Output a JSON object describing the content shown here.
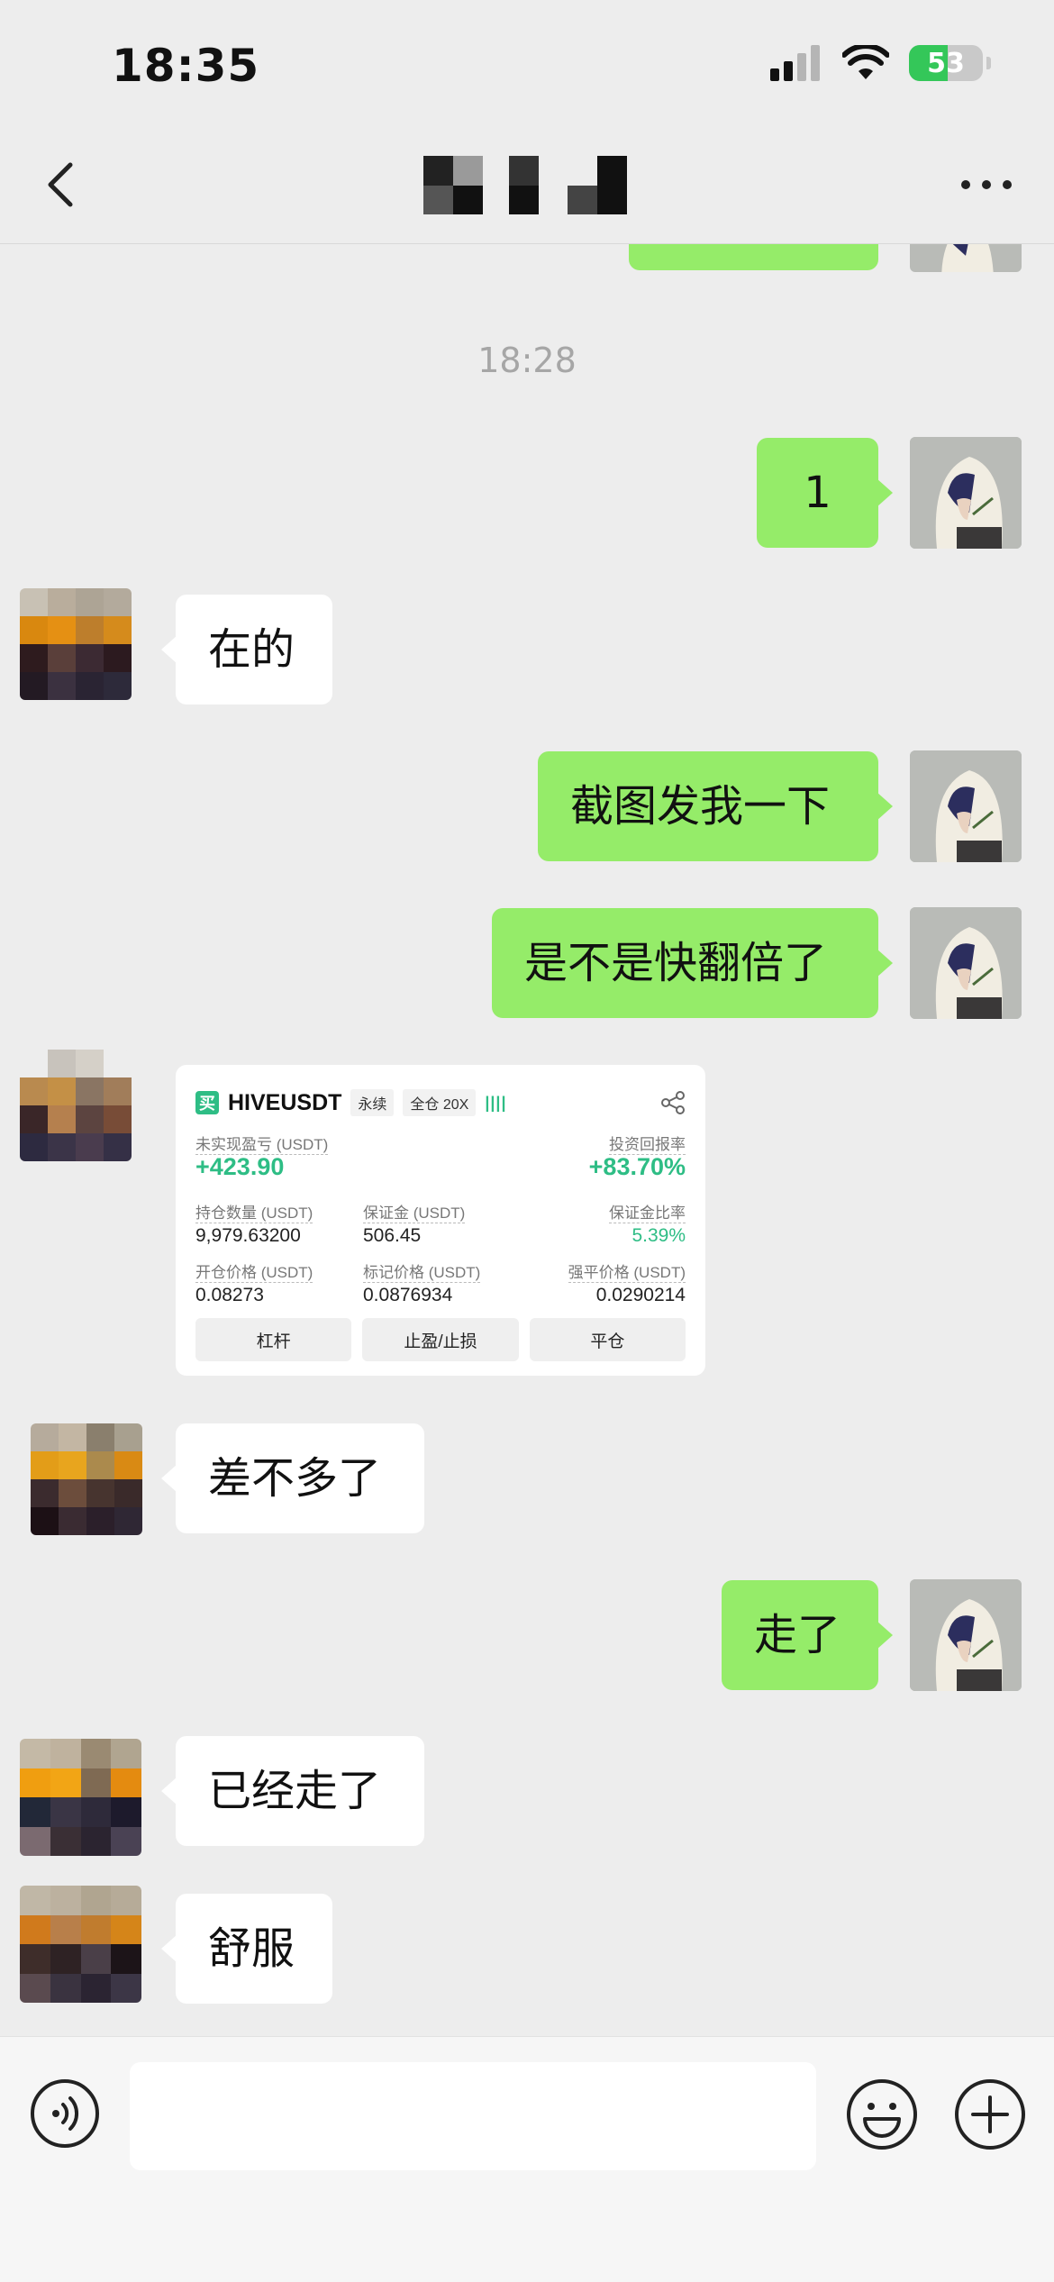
{
  "status_bar": {
    "time": "18:35",
    "battery": "53",
    "battery_level": 0.53
  },
  "header": {
    "title": ""
  },
  "chat": {
    "timestamp": "18:28",
    "messages": [
      {
        "from": "me",
        "text": "1"
      },
      {
        "from": "other",
        "text": "在的"
      },
      {
        "from": "me",
        "text": "截图发我一下"
      },
      {
        "from": "me",
        "text": "是不是快翻倍了"
      },
      {
        "from": "other",
        "type": "image"
      },
      {
        "from": "other",
        "text": "差不多了"
      },
      {
        "from": "me",
        "text": "走了"
      },
      {
        "from": "other",
        "text": "已经走了"
      },
      {
        "from": "other",
        "text": "舒服"
      }
    ]
  },
  "trade_card": {
    "buy_tag": "买",
    "pair": "HIVEUSDT",
    "contract_type": "永续",
    "margin_mode": "全仓 20X",
    "strength_bars": "||||",
    "pnl_label": "未实现盈亏 (USDT)",
    "pnl_value": "+423.90",
    "roi_label": "投资回报率",
    "roi_value": "+83.70%",
    "position_label": "持仓数量 (USDT)",
    "position_value": "9,979.63200",
    "margin_label": "保证金 (USDT)",
    "margin_value": "506.45",
    "margin_ratio_label": "保证金比率",
    "margin_ratio_value": "5.39%",
    "entry_label": "开仓价格 (USDT)",
    "entry_value": "0.08273",
    "mark_label": "标记价格 (USDT)",
    "mark_value": "0.0876934",
    "liq_label": "强平价格 (USDT)",
    "liq_value": "0.0290214",
    "btn_leverage": "杠杆",
    "btn_tpsl": "止盈/止损",
    "btn_close": "平仓"
  },
  "colors": {
    "my_bubble": "#95ec69",
    "other_bubble": "#ffffff",
    "background": "#ededed",
    "profit_green": "#2ebd85"
  },
  "icons": [
    "back-icon",
    "more-icon",
    "share-icon",
    "voice-icon",
    "emoji-icon",
    "plus-icon",
    "signal-icon",
    "wifi-icon",
    "battery-icon"
  ]
}
